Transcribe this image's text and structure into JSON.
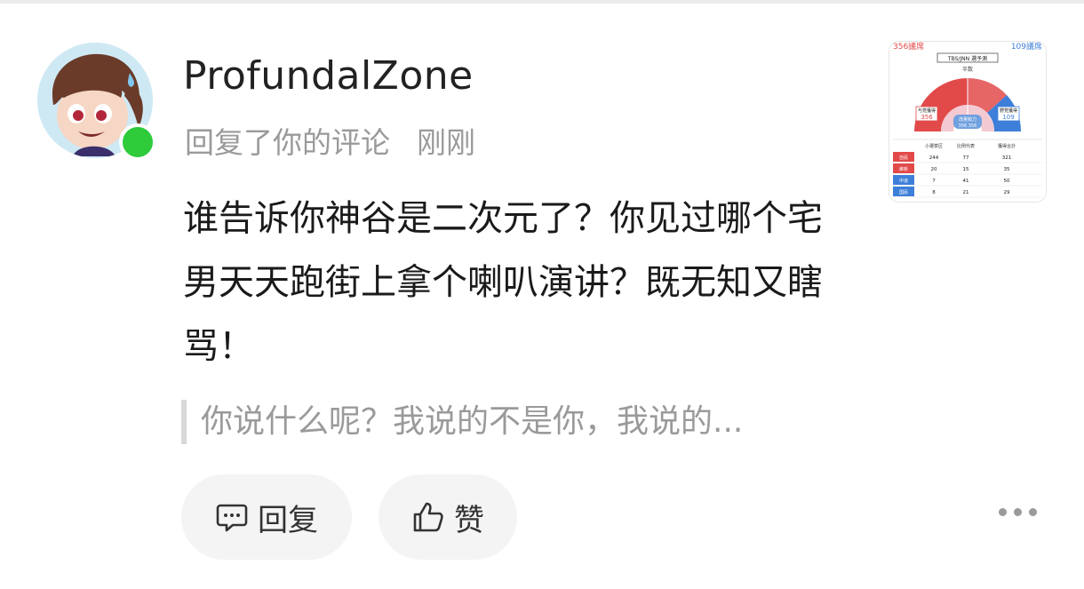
{
  "user": {
    "name": "ProfundalZone",
    "status": "online"
  },
  "meta": {
    "action": "回复了你的评论",
    "time": "刚刚"
  },
  "comment": {
    "text": "谁告诉你神谷是二次元了？你见过哪个宅男天天跑街上拿个喇叭演讲？既无知又瞎骂！"
  },
  "quoted": {
    "text": "你说什么呢？我说的不是你，我说的..."
  },
  "actions": {
    "reply_label": "回复",
    "like_label": "赞"
  },
  "thumbnail": {
    "left_count": "356議席",
    "right_count": "109議席",
    "title": "TBS/JNN 選予測",
    "midline": "半数",
    "ruling_label": "与党獲得",
    "ruling_value": "356",
    "opposition_label": "野党獲得",
    "opposition_value": "109",
    "center_label": "改憲勢力",
    "center_values": "356  356",
    "table": {
      "headers": [
        "小選挙区",
        "比例代表",
        "獲得合計"
      ],
      "rows": [
        {
          "party": "自民",
          "color": "#e24a4a",
          "cells": [
            "244",
            "77",
            "321"
          ]
        },
        {
          "party": "維新",
          "color": "#e24a4a",
          "cells": [
            "20",
            "15",
            "35"
          ]
        },
        {
          "party": "中道",
          "color": "#3d7fd9",
          "cells": [
            "7",
            "41",
            "50"
          ]
        },
        {
          "party": "国民",
          "color": "#3d7fd9",
          "cells": [
            "8",
            "21",
            "29"
          ]
        }
      ]
    }
  },
  "colors": {
    "online": "#2ecb3a",
    "ruling": "#e24a4a",
    "opposition": "#3d7fd9",
    "muted_text": "#9a9a9a"
  }
}
